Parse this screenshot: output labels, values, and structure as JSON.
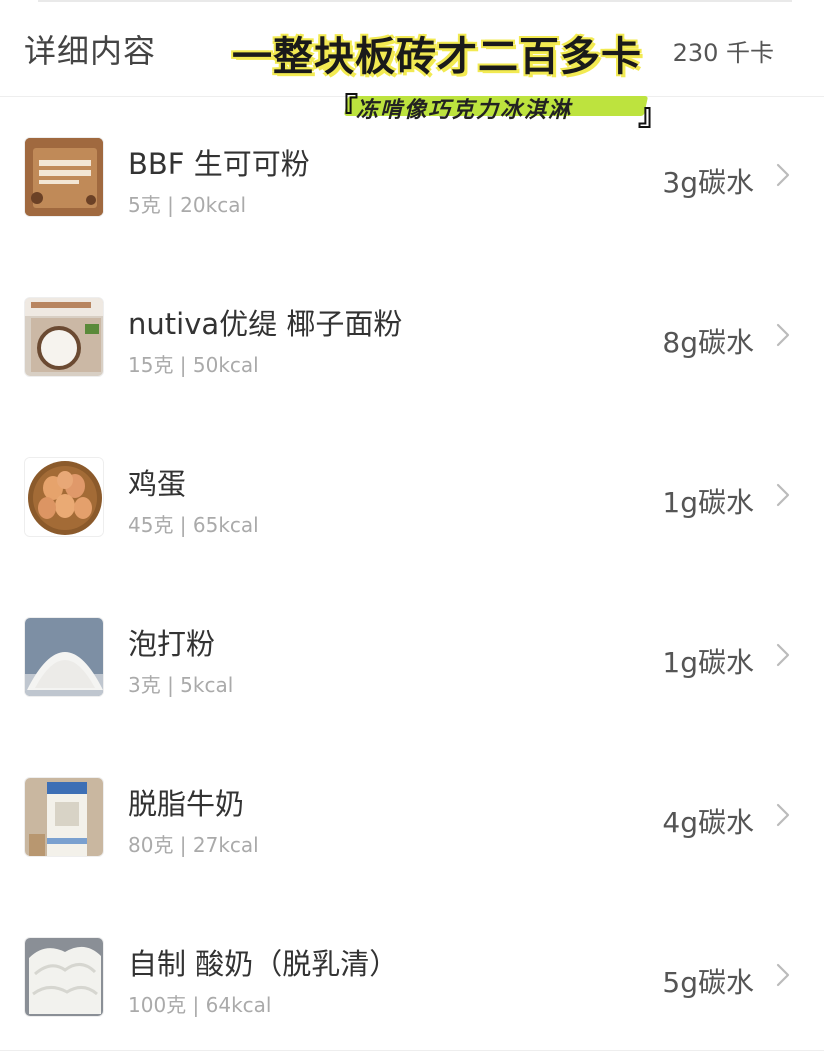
{
  "header": {
    "title": "详细内容",
    "total": "230 千卡"
  },
  "overlay": {
    "banner": "一整块板砖才二百多卡",
    "bracket_left": "『",
    "subtitle": "冻啃像巧克力冰淇淋",
    "bracket_right": "』"
  },
  "items": [
    {
      "name": "BBF 生可可粉",
      "detail": "5克 | 20kcal",
      "carb": "3g碳水",
      "icon": "cacao-powder-thumb"
    },
    {
      "name": "nutiva优缇 椰子面粉",
      "detail": "15克 | 50kcal",
      "carb": "8g碳水",
      "icon": "coconut-flour-thumb"
    },
    {
      "name": "鸡蛋",
      "detail": "45克 | 65kcal",
      "carb": "1g碳水",
      "icon": "eggs-thumb"
    },
    {
      "name": "泡打粉",
      "detail": "3克 | 5kcal",
      "carb": "1g碳水",
      "icon": "baking-powder-thumb"
    },
    {
      "name": "脱脂牛奶",
      "detail": "80克 | 27kcal",
      "carb": "4g碳水",
      "icon": "skim-milk-thumb"
    },
    {
      "name": "自制 酸奶（脱乳清）",
      "detail": "100克 | 64kcal",
      "carb": "5g碳水",
      "icon": "yogurt-thumb"
    }
  ],
  "colors": {
    "banner_highlight": "#f2ea52",
    "subtitle_highlight": "#bde33e",
    "secondary_text": "#aaaaaa"
  }
}
